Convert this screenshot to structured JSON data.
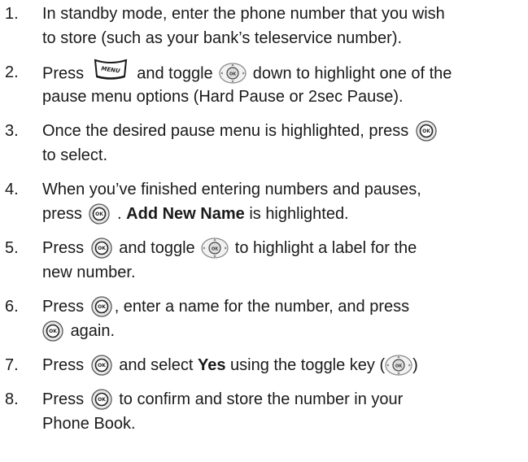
{
  "steps": [
    {
      "number": "1.",
      "lines": [
        "In standby mode, enter the phone number that you wish",
        "to store (such as your bank’s teleservice number)."
      ]
    },
    {
      "number": "2.",
      "line1_a": "Press",
      "line1_b": "and toggle",
      "line1_c": "down to highlight one of the",
      "line2": "pause menu options (Hard Pause or 2sec Pause)."
    },
    {
      "number": "3.",
      "line1": "Once the desired pause menu is highlighted, press",
      "line2": "to select."
    },
    {
      "number": "4.",
      "line1": "When you’ve finished entering numbers and pauses,",
      "line2_a": "press",
      "line2_b": ".",
      "line2_bold": "Add New Name",
      "line2_c": "is highlighted."
    },
    {
      "number": "5.",
      "line1_a": "Press",
      "line1_b": "and toggle",
      "line1_c": "to highlight a label for the",
      "line2": "new number."
    },
    {
      "number": "6.",
      "line1_a": "Press",
      "line1_b": ", enter a name for the number, and press",
      "line2": "again."
    },
    {
      "number": "7.",
      "line1_a": "Press",
      "line1_b": "and select",
      "line1_bold": "Yes",
      "line1_c": "using the toggle key (",
      "line1_d": ")"
    },
    {
      "number": "8.",
      "line1_a": "Press",
      "line1_b": "to confirm and store the number in your",
      "line2": "Phone Book."
    }
  ],
  "icons": {
    "ok_key": "ok-key-icon",
    "nav_key": "navigation-toggle-key-icon",
    "menu_key": "menu-key-icon",
    "ok_key_label": "OK",
    "menu_key_label": "MENU"
  }
}
